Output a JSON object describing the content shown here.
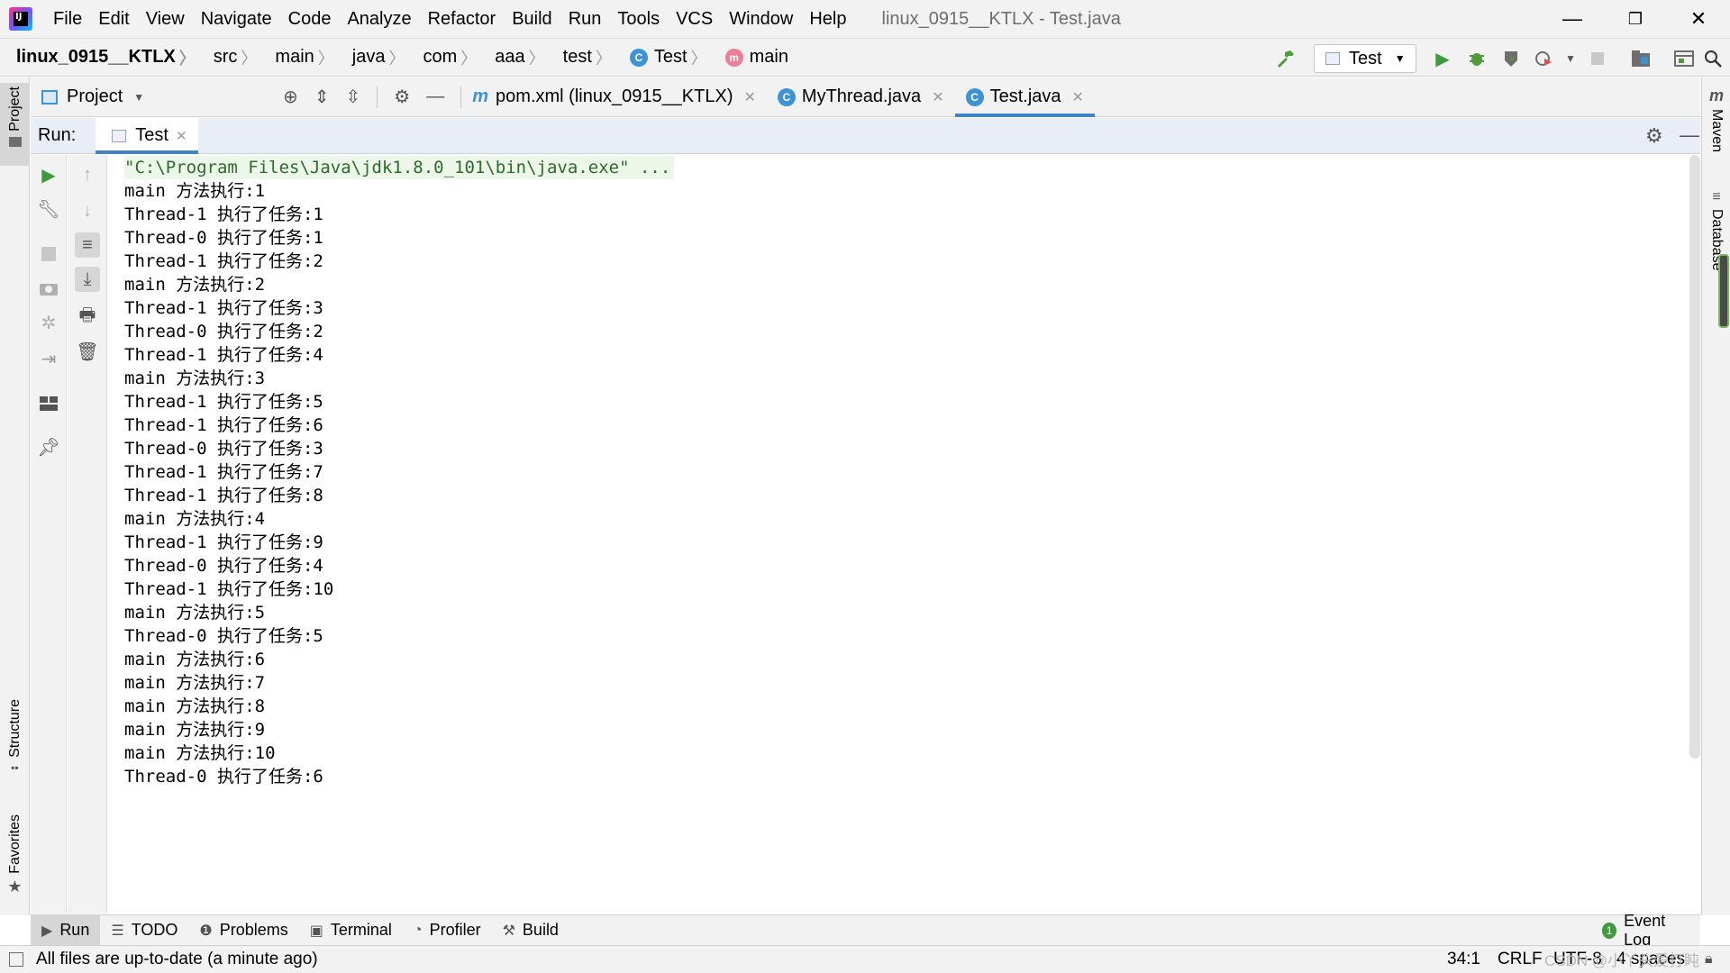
{
  "window": {
    "title": "linux_0915__KTLX - Test.java",
    "minimize": "—",
    "restore": "❐",
    "close": "✕"
  },
  "menu": [
    "File",
    "Edit",
    "View",
    "Navigate",
    "Code",
    "Analyze",
    "Refactor",
    "Build",
    "Run",
    "Tools",
    "VCS",
    "Window",
    "Help"
  ],
  "breadcrumb": [
    "linux_0915__KTLX",
    "src",
    "main",
    "java",
    "com",
    "aaa",
    "test",
    "Test",
    "main"
  ],
  "toolbar": {
    "run_config": "Test"
  },
  "left_stripe": {
    "project": "Project",
    "structure": "Structure",
    "favorites": "Favorites"
  },
  "right_stripe": {
    "maven": "Maven",
    "database": "Database"
  },
  "project_panel": {
    "label": "Project"
  },
  "editor_tabs": [
    {
      "label": "pom.xml (linux_0915__KTLX)",
      "icon": "m"
    },
    {
      "label": "MyThread.java",
      "icon": "C"
    },
    {
      "label": "Test.java",
      "icon": "C"
    }
  ],
  "run_window": {
    "label": "Run:",
    "tab": "Test"
  },
  "console": {
    "command": "\"C:\\Program Files\\Java\\jdk1.8.0_101\\bin\\java.exe\" ...",
    "lines": [
      "main 方法执行:1",
      "Thread-1 执行了任务:1",
      "Thread-0 执行了任务:1",
      "Thread-1 执行了任务:2",
      "main 方法执行:2",
      "Thread-1 执行了任务:3",
      "Thread-0 执行了任务:2",
      "Thread-1 执行了任务:4",
      "main 方法执行:3",
      "Thread-1 执行了任务:5",
      "Thread-1 执行了任务:6",
      "Thread-0 执行了任务:3",
      "Thread-1 执行了任务:7",
      "Thread-1 执行了任务:8",
      "main 方法执行:4",
      "Thread-1 执行了任务:9",
      "Thread-0 执行了任务:4",
      "Thread-1 执行了任务:10",
      "main 方法执行:5",
      "Thread-0 执行了任务:5",
      "main 方法执行:6",
      "main 方法执行:7",
      "main 方法执行:8",
      "main 方法执行:9",
      "main 方法执行:10",
      "Thread-0 执行了任务:6"
    ]
  },
  "bottom_tabs": [
    "Run",
    "TODO",
    "Problems",
    "Terminal",
    "Profiler",
    "Build"
  ],
  "event_log": "Event Log",
  "event_log_count": "1",
  "status": {
    "message": "All files are up-to-date (a minute ago)",
    "position": "34:1",
    "line_sep": "CRLF",
    "encoding": "UTF-8",
    "indent": "4 spaces",
    "watermark": "CSDN @小丫头爱打盹"
  },
  "colors": {
    "accent": "#4083c9",
    "run_green": "#3d9a3d",
    "cmd_bg": "#edf7e9"
  }
}
